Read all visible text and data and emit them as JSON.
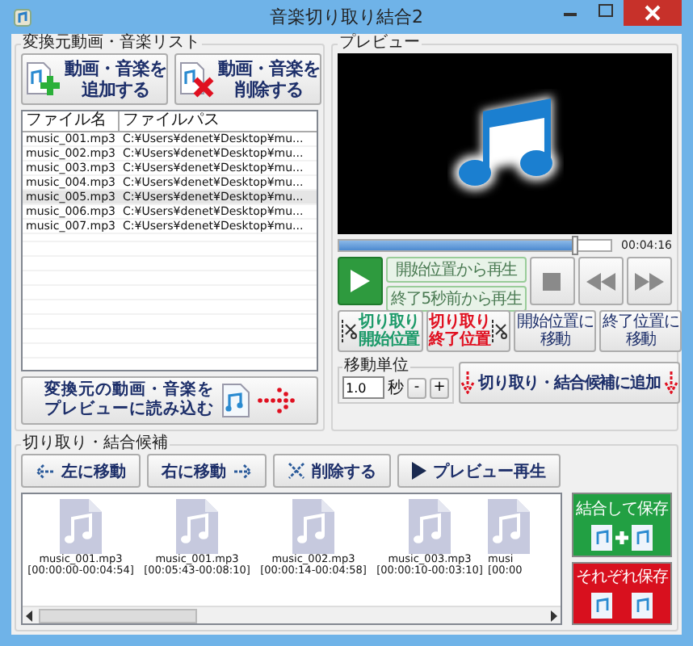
{
  "window": {
    "title": "音楽切り取り結合2"
  },
  "source_list": {
    "title": "変換元動画・音楽リスト",
    "buttons": [
      {
        "kind": "add",
        "lines": [
          "動画・音楽を",
          "追加する"
        ]
      },
      {
        "kind": "delete",
        "lines": [
          "動画・音楽を",
          "削除する"
        ]
      }
    ],
    "table": {
      "columns": [
        "ファイル名",
        "ファイルパス"
      ],
      "rows": [
        {
          "name": "music_001.mp3",
          "path": "C:¥Users¥denet¥Desktop¥mu...",
          "selected": false
        },
        {
          "name": "music_002.mp3",
          "path": "C:¥Users¥denet¥Desktop¥mu...",
          "selected": false
        },
        {
          "name": "music_003.mp3",
          "path": "C:¥Users¥denet¥Desktop¥mu...",
          "selected": false
        },
        {
          "name": "music_004.mp3",
          "path": "C:¥Users¥denet¥Desktop¥mu...",
          "selected": false
        },
        {
          "name": "music_005.mp3",
          "path": "C:¥Users¥denet¥Desktop¥mu...",
          "selected": true
        },
        {
          "name": "music_006.mp3",
          "path": "C:¥Users¥denet¥Desktop¥mu...",
          "selected": false
        },
        {
          "name": "music_007.mp3",
          "path": "C:¥Users¥denet¥Desktop¥mu...",
          "selected": false
        }
      ]
    },
    "load_button": [
      "変換元の動画・音楽を",
      "プレビューに読み込む"
    ]
  },
  "preview": {
    "title": "プレビュー",
    "seek": {
      "level": 0.87
    },
    "time": "00:04:16",
    "play_from_start": "開始位置から再生",
    "play_before_end": "終了5秒前から再生",
    "cut_buttons": [
      {
        "kind": "start",
        "lines": [
          "切り取り",
          "開始位置"
        ]
      },
      {
        "kind": "end",
        "lines": [
          "切り取り",
          "終了位置"
        ]
      },
      {
        "kind": "move",
        "lines": [
          "開始位置に",
          "移動"
        ]
      },
      {
        "kind": "move",
        "lines": [
          "終了位置に",
          "移動"
        ]
      }
    ],
    "move_unit": {
      "title": "移動単位",
      "value": "1.0",
      "unit": "秒",
      "minus": "-",
      "plus": "+"
    },
    "add_candidate": "切り取り・結合候補に追加"
  },
  "candidates": {
    "title": "切り取り・結合候補",
    "buttons": [
      {
        "kind": "left",
        "label": "左に移動"
      },
      {
        "kind": "right",
        "label": "右に移動"
      },
      {
        "kind": "delete",
        "label": "削除する"
      },
      {
        "kind": "play",
        "label": "プレビュー再生"
      }
    ],
    "items": [
      {
        "name": "music_001.mp3",
        "range": "[00:00:00-00:04:54]"
      },
      {
        "name": "music_001.mp3",
        "range": "[00:05:43-00:08:10]"
      },
      {
        "name": "music_002.mp3",
        "range": "[00:00:14-00:04:58]"
      },
      {
        "name": "music_003.mp3",
        "range": "[00:00:10-00:03:10]"
      },
      {
        "name": "musi",
        "range": "[00:00"
      }
    ],
    "save_buttons": [
      {
        "kind": "join",
        "label": "結合して保存"
      },
      {
        "kind": "separate",
        "label": "それぞれ保存"
      }
    ]
  }
}
